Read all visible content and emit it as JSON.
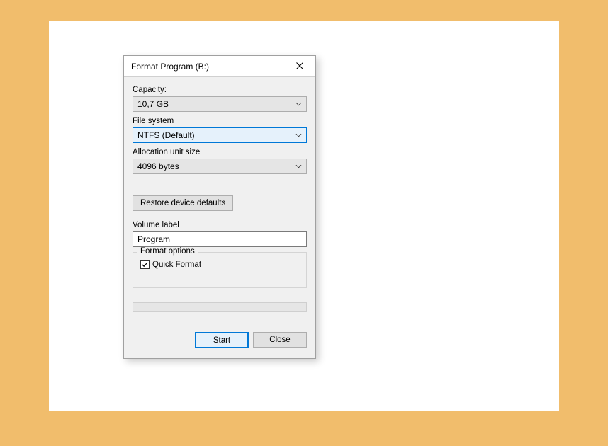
{
  "window": {
    "title": "Format Program (B:)"
  },
  "labels": {
    "capacity": "Capacity:",
    "filesystem": "File system",
    "allocation": "Allocation unit size",
    "volume": "Volume label",
    "format_options": "Format options"
  },
  "values": {
    "capacity": "10,7 GB",
    "filesystem": "NTFS (Default)",
    "allocation": "4096 bytes",
    "volume": "Program"
  },
  "buttons": {
    "restore": "Restore device defaults",
    "start": "Start",
    "close": "Close"
  },
  "checkbox": {
    "quick_format": "Quick Format"
  }
}
